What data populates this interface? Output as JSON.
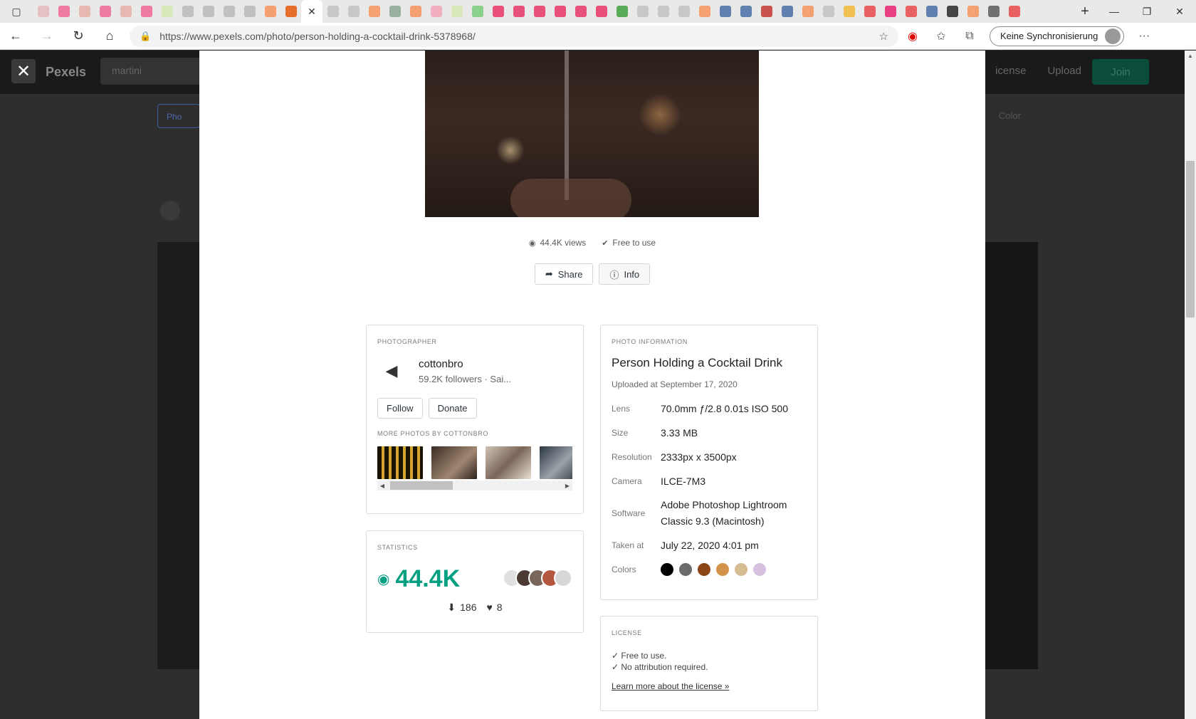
{
  "browser": {
    "url": "https://www.pexels.com/photo/person-holding-a-cocktail-drink-5378968/",
    "sync_label": "Keine Synchronisierung",
    "tab_favicon_colors": [
      "#e7c0c6",
      "#ef7aa0",
      "#e6b8b0",
      "#ef7aa0",
      "#e6b8b0",
      "#ef7aa0",
      "#d8e8b8",
      "#c0c0c0",
      "#c0c0c0",
      "#c0c0c0",
      "#c0c0c0",
      "#f4a070",
      "#e66d2a",
      "#ffffff",
      "#c8c8c8",
      "#c8c8c8",
      "#f4a070",
      "#9ab0a0",
      "#f4a070",
      "#f0b0c0",
      "#d8e8b8",
      "#8bd08b",
      "#e8507a",
      "#e8507a",
      "#e8507a",
      "#e8507a",
      "#e8507a",
      "#e8507a",
      "#5aaa5a",
      "#c8c8c8",
      "#c8c8c8",
      "#c8c8c8",
      "#f4a070",
      "#6080b0",
      "#6080b0",
      "#c8524c",
      "#6080b0",
      "#f4a070",
      "#c8c8c8",
      "#f0c050",
      "#e86060",
      "#e84080",
      "#e86060",
      "#6080b0",
      "#444444",
      "#f4a070",
      "#707070",
      "#e86060"
    ]
  },
  "background_page": {
    "logo": "Pexels",
    "search_value": "martini",
    "nav": [
      "icense",
      "Upload",
      "···"
    ],
    "join": "Join",
    "filter": "Pho",
    "color": "Color"
  },
  "stats_line": {
    "views": "44.4K views",
    "free": "Free to use"
  },
  "actions": {
    "share": "Share",
    "info": "Info"
  },
  "photographer": {
    "label": "Photographer",
    "name": "cottonbro",
    "sub": "59.2K followers · Sai...",
    "follow": "Follow",
    "donate": "Donate",
    "more_label": "More photos by cottonbro"
  },
  "statistics": {
    "label": "Statistics",
    "views": "44.4K",
    "downloads": "186",
    "likes": "8"
  },
  "photo_info": {
    "label": "Photo information",
    "title": "Person Holding a Cocktail Drink",
    "uploaded": "Uploaded at September 17, 2020",
    "rows": [
      {
        "k": "Lens",
        "v": "70.0mm ƒ/2.8 0.01s ISO 500"
      },
      {
        "k": "Size",
        "v": "3.33 MB"
      },
      {
        "k": "Resolution",
        "v": "2333px x 3500px"
      },
      {
        "k": "Camera",
        "v": "ILCE-7M3"
      },
      {
        "k": "Software",
        "v": "Adobe Photoshop Lightroom Classic 9.3 (Macintosh)"
      },
      {
        "k": "Taken at",
        "v": "July 22, 2020 4:01 pm"
      }
    ],
    "colors_label": "Colors",
    "colors": [
      "#000000",
      "#6b6b6b",
      "#8c4515",
      "#d4934a",
      "#d8bc94",
      "#d8c0e0"
    ]
  },
  "license": {
    "label": "License",
    "line1": "✓ Free to use.",
    "line2": "✓ No attribution required.",
    "link": "Learn more about the license »"
  }
}
